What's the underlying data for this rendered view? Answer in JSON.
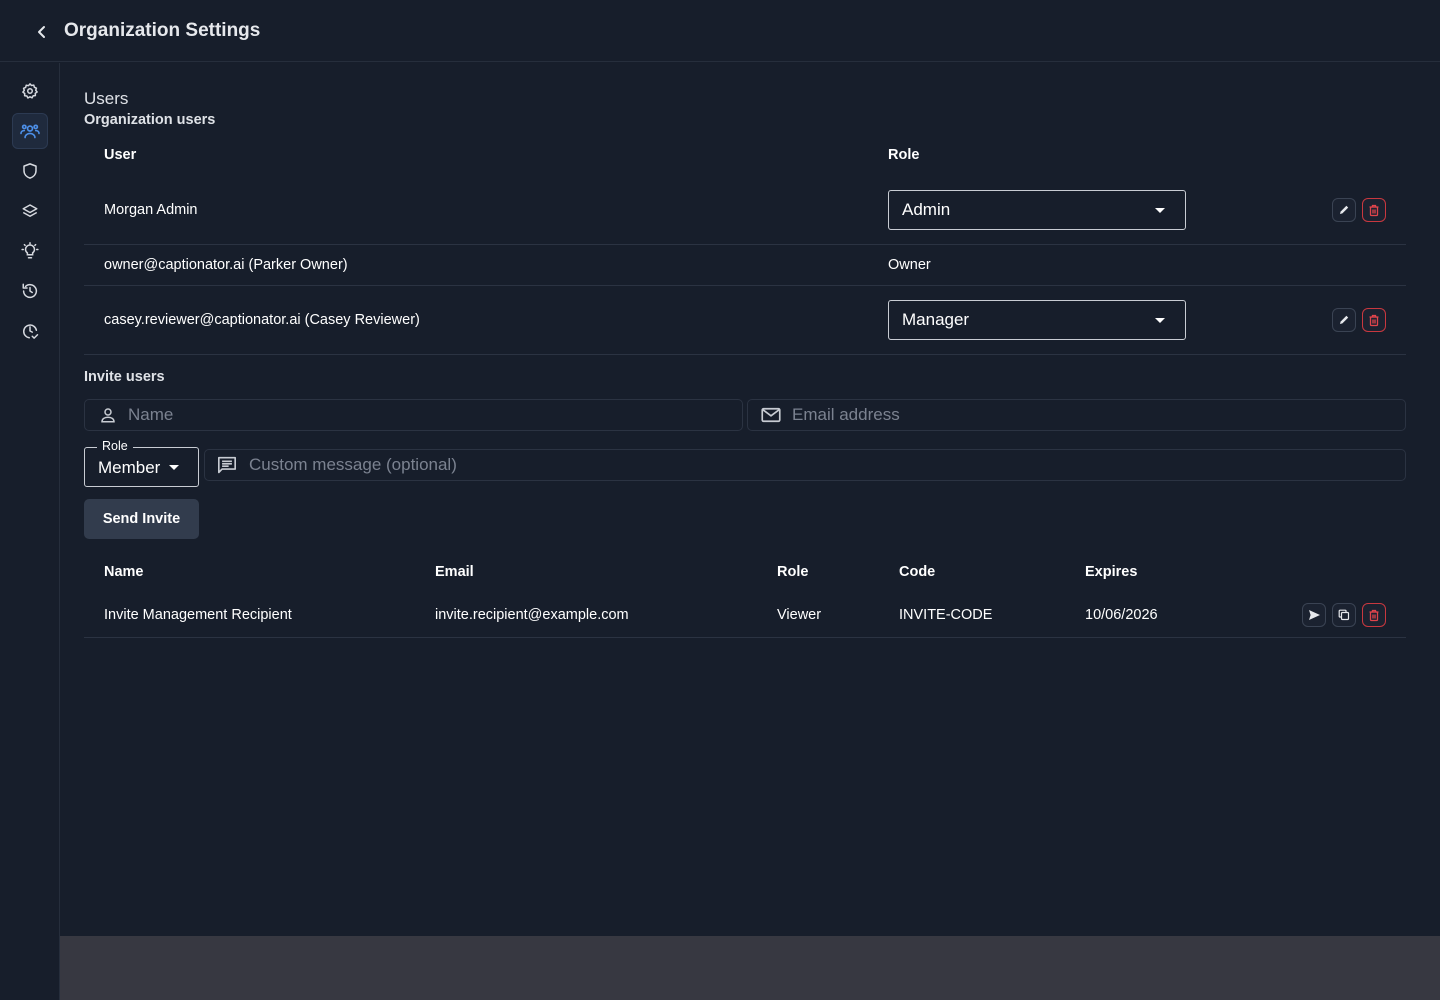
{
  "header": {
    "title": "Organization Settings"
  },
  "sidebar": {
    "items": [
      {
        "icon": "gear-icon",
        "active": false
      },
      {
        "icon": "users-icon",
        "active": true
      },
      {
        "icon": "shield-icon",
        "active": false
      },
      {
        "icon": "layers-icon",
        "active": false
      },
      {
        "icon": "lightbulb-icon",
        "active": false
      },
      {
        "icon": "history-icon",
        "active": false
      },
      {
        "icon": "clock-check-icon",
        "active": false
      }
    ]
  },
  "users": {
    "section_title": "Users",
    "subtitle": "Organization users",
    "columns": {
      "user": "User",
      "role": "Role"
    },
    "rows": [
      {
        "user": "Morgan Admin",
        "role": "Admin",
        "editable": true
      },
      {
        "user": "owner@captionator.ai (Parker Owner)",
        "role": "Owner",
        "editable": false
      },
      {
        "user": "casey.reviewer@captionator.ai (Casey Reviewer)",
        "role": "Manager",
        "editable": true
      }
    ]
  },
  "invite": {
    "title": "Invite users",
    "name_placeholder": "Name",
    "email_placeholder": "Email address",
    "role_label": "Role",
    "role_value": "Member",
    "message_placeholder": "Custom message (optional)",
    "send_label": "Send Invite"
  },
  "invites_table": {
    "columns": {
      "name": "Name",
      "email": "Email",
      "role": "Role",
      "code": "Code",
      "expires": "Expires"
    },
    "rows": [
      {
        "name": "Invite Management Recipient",
        "email": "invite.recipient@example.com",
        "role": "Viewer",
        "code": "INVITE-CODE",
        "expires": "10/06/2026"
      }
    ]
  },
  "colors": {
    "background": "#171e2b",
    "accent": "#4d8fe8",
    "danger": "#e0454c",
    "footer": "#373841"
  }
}
